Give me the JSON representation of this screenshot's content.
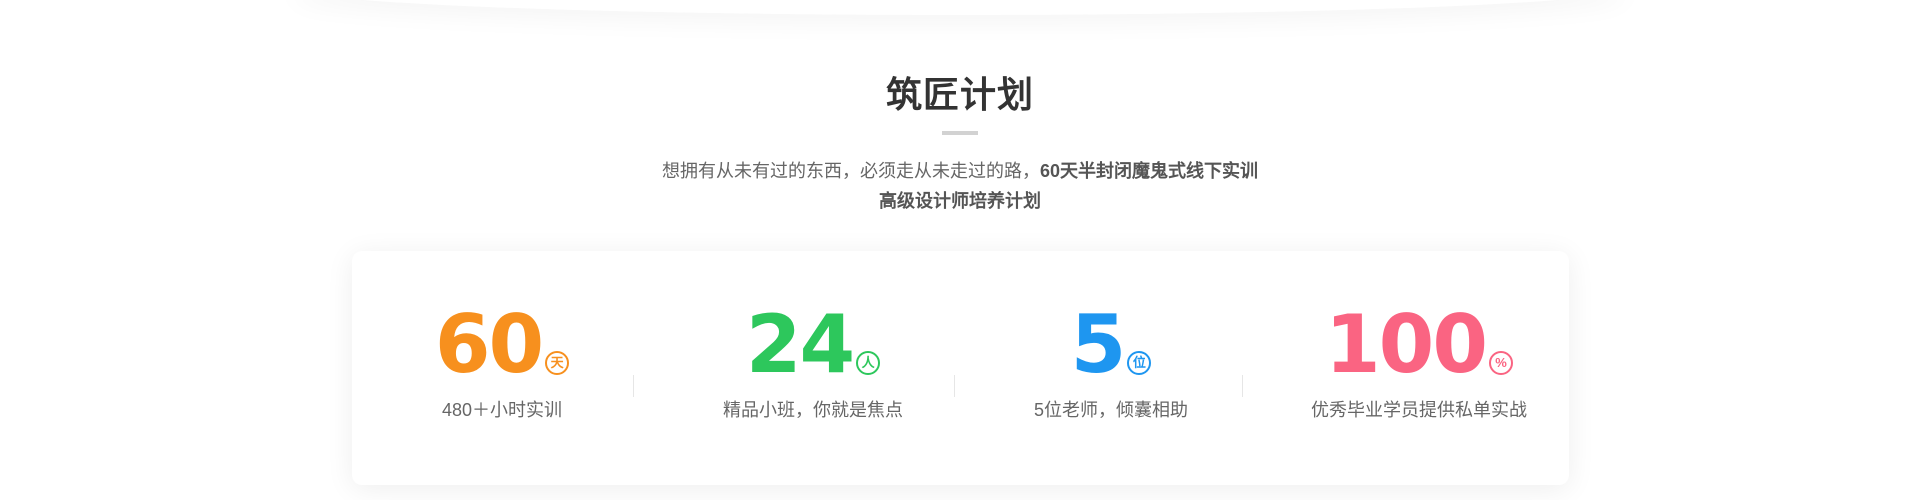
{
  "section": {
    "title": "筑匠计划",
    "subtitle_line1_normal": "想拥有从未有过的东西，必须走从未走过的路，",
    "subtitle_line1_strong": "60天半封闭魔鬼式线下实训",
    "subtitle_line2": "高级设计师培养计划"
  },
  "stats": [
    {
      "number": "60",
      "unit": "天",
      "label": "480＋小时实训",
      "color": "#f7901e"
    },
    {
      "number": "24",
      "unit": "人",
      "label": "精品小班，你就是焦点",
      "color": "#2dc75c"
    },
    {
      "number": "5",
      "unit": "位",
      "label": "5位老师，倾囊相助",
      "color": "#1e96f0"
    },
    {
      "number": "100",
      "unit": "%",
      "label": "优秀毕业学员提供私单实战",
      "color": "#fa6482"
    }
  ]
}
